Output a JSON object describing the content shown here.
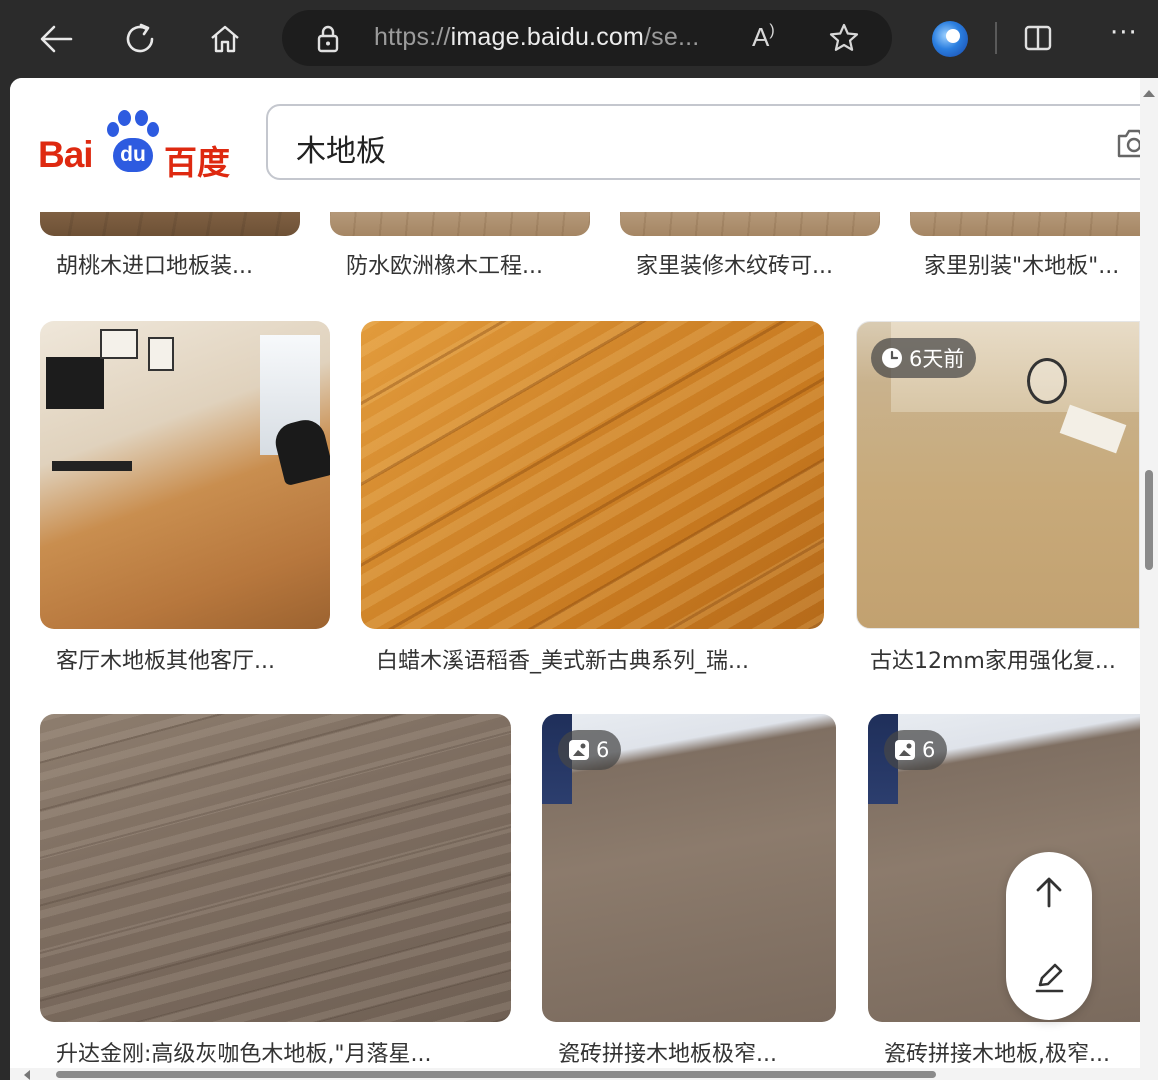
{
  "browser": {
    "url_scheme": "https://",
    "url_host": "image.baidu.com",
    "url_rest": "/se...",
    "read_aloud_label": "A)",
    "menu_label": "···"
  },
  "header": {
    "logo_latin": "Bai",
    "logo_paw_text": "du",
    "logo_cn": "百度",
    "search_value": "木地板"
  },
  "row1": {
    "captions": [
      "胡桃木进口地板装...",
      "防水欧洲橡木工程...",
      "家里装修木纹砖可...",
      "家里别装\"木地板\"..."
    ]
  },
  "row2": {
    "captions": [
      "客厅木地板其他客厅...",
      "白蜡木溪语稻香_美式新古典系列_瑞...",
      "古达12mm家用强化复..."
    ],
    "badge_time": "6天前"
  },
  "row3": {
    "captions": [
      "升达金刚:高级灰咖色木地板,\"月落星...",
      "瓷砖拼接木地板极窄...",
      "瓷砖拼接木地板,极窄..."
    ],
    "badge_count_a": "6",
    "badge_count_b": "6"
  },
  "colors": {
    "brand_red": "#de2910",
    "brand_blue": "#2d5be0"
  }
}
